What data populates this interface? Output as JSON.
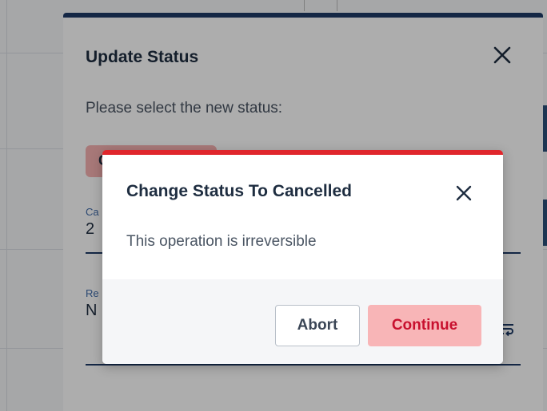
{
  "modal": {
    "title": "Update Status",
    "close_icon": "close-icon",
    "prompt": "Please select the new status:",
    "selected_status_chip": "C",
    "fields": [
      {
        "label": "Ca",
        "value": "2"
      },
      {
        "label": "Re",
        "value": "N"
      }
    ],
    "wrap_icon": "wrap-text-icon"
  },
  "confirm_dialog": {
    "title": "Change Status To Cancelled",
    "close_icon": "close-icon",
    "message": "This operation is irreversible",
    "abort_label": "Abort",
    "continue_label": "Continue"
  },
  "colors": {
    "modal_accent": "#1e3a66",
    "dialog_accent": "#e0262c",
    "continue_bg": "#f8b5b7",
    "continue_text": "#c8102e"
  }
}
